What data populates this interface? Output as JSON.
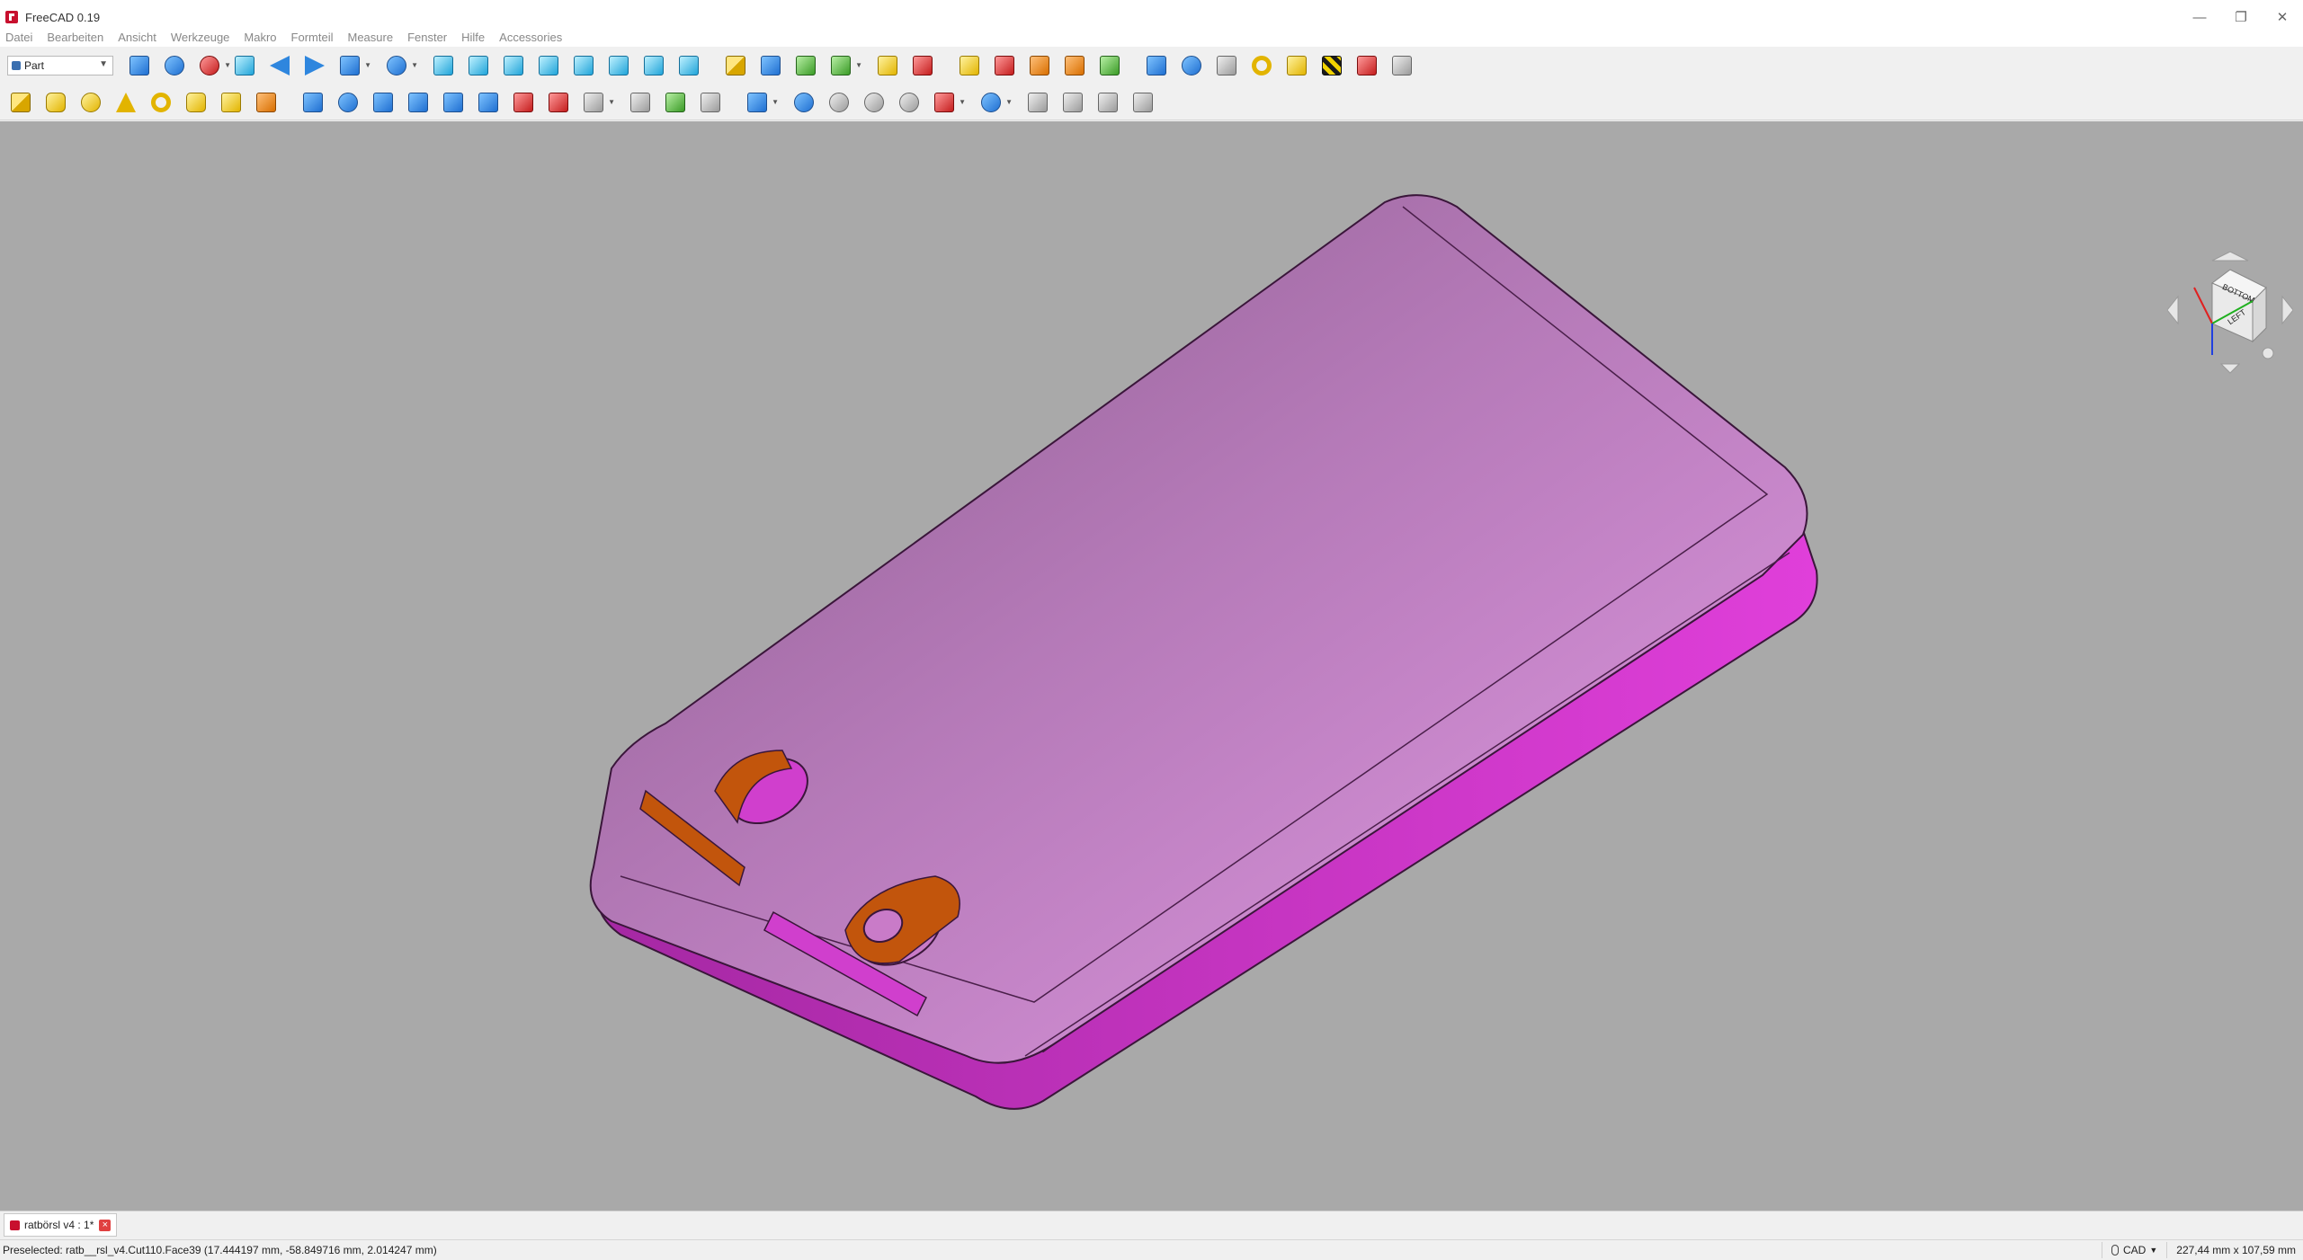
{
  "window": {
    "title": "FreeCAD 0.19",
    "minimize": "—",
    "restore": "❐",
    "close": "✕"
  },
  "menu": [
    "Datei",
    "Bearbeiten",
    "Ansicht",
    "Werkzeuge",
    "Makro",
    "Formteil",
    "Measure",
    "Fenster",
    "Hilfe",
    "Accessories"
  ],
  "toolbar": {
    "workbench": "Part"
  },
  "document_tab": {
    "label": "ratbörsl v4 : 1*"
  },
  "status": {
    "preselection": "Preselected: ratb__rsl_v4.Cut110.Face39 (17.444197 mm, -58.849716 mm, 2.014247 mm)",
    "navigation_style": "CAD",
    "dimensions": "227,44 mm x 107,59 mm"
  },
  "navcube": {
    "faces": [
      "BOTTOM",
      "LEFT"
    ]
  },
  "colors": {
    "background": "#a9a9a9",
    "body_top": "#c98acb",
    "body_side": "#d93fd3",
    "cut_faces": "#c2550c"
  },
  "icons": {
    "workbench": "part-workbench-icon",
    "view": [
      "fit-all-icon",
      "fit-selection-icon",
      "draw-style-icon",
      "bounding-box-icon",
      "back-icon",
      "forward-icon",
      "sync-view-icon",
      "zoom-icon",
      "axonometric-icon",
      "front-view-icon",
      "top-view-icon",
      "right-view-icon",
      "rear-view-icon",
      "bottom-view-icon",
      "left-view-icon",
      "measure-distance-icon"
    ],
    "structure": [
      "create-part-icon",
      "create-group-icon",
      "link-icon",
      "link-actions-icon"
    ],
    "misc": [
      "macro-record-icon",
      "macro-stop-icon",
      "macro-edit-icon",
      "macro-execute-icon",
      "macro-debug-icon",
      "macro-step-icon",
      "macro-toggle-icon",
      "blue-shape-icon",
      "solid-icon",
      "texture-icon",
      "ring-icon",
      "stack-icon",
      "stripes-icon",
      "cube-stack-icon",
      "image-icon"
    ],
    "primitives": [
      "box-icon",
      "cylinder-icon",
      "sphere-icon",
      "cone-icon",
      "torus-icon",
      "tube-icon",
      "primitives-icon",
      "shape-builder-icon"
    ],
    "modifiers": [
      "extrude-icon",
      "revolve-icon",
      "mirror-icon",
      "fillet-icon",
      "chamfer-icon",
      "make-face-icon",
      "ruled-surface-icon",
      "loft-icon",
      "sweep-icon",
      "section-icon",
      "cross-sections-icon",
      "offset-icon",
      "thickness-icon"
    ],
    "booleans": [
      "compound-icon",
      "boolean-icon",
      "cut-icon",
      "fuse-icon",
      "common-icon",
      "join-icon",
      "split-icon",
      "check-geometry-icon",
      "defeaturing-icon",
      "attachment-icon",
      "projection-icon"
    ]
  }
}
